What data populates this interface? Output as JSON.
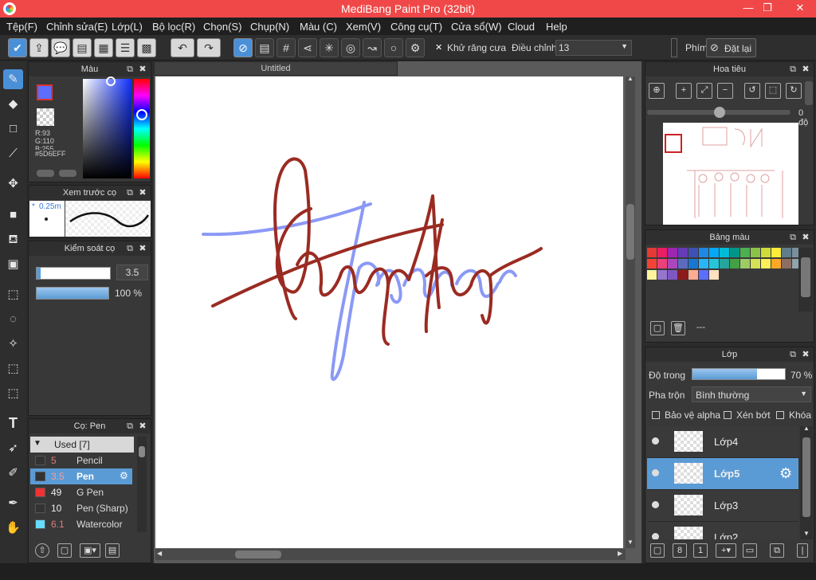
{
  "window": {
    "title": "MediBang Paint Pro (32bit)",
    "minimize": "—",
    "maximize": "❐",
    "close": "✕"
  },
  "menu": [
    "Tệp(F)",
    "Chỉnh sửa(E)",
    "Lớp(L)",
    "Bộ lọc(R)",
    "Chọn(S)",
    "Chụp(N)",
    "Màu (C)",
    "Xem(V)",
    "Công cụ(T)",
    "Cửa sổ(W)",
    "Cloud",
    "Help"
  ],
  "toolbar": {
    "antialias_label": "Khử răng cưa",
    "adjust_label": "Điều chỉnh",
    "adjust_value": "13",
    "key_label": "Phím",
    "reset_label": "Đặt lại"
  },
  "color_panel": {
    "title": "Màu",
    "r": "R:93",
    "g": "G:110",
    "b": "B:255",
    "hex": "#5D6EFF",
    "fg_color": "#5d6eff",
    "bg_color": "#ff66cc"
  },
  "preview_panel": {
    "title": "Xem trước cọ",
    "size": "0.25m"
  },
  "brush_control": {
    "title": "Kiểm soát cọ",
    "size_value": "3.5",
    "opacity_value": "100 %",
    "size_fraction": 0.05,
    "opacity_fraction": 1.0
  },
  "brush_panel": {
    "title": "Cọ: Pen",
    "group": "Used [7]",
    "items": [
      {
        "size": "5",
        "name": "Pencil",
        "color": "#333333",
        "size_color": "#e07a7a"
      },
      {
        "size": "3.5",
        "name": "Pen",
        "color": "#333333",
        "size_color": "#f0a0a0",
        "selected": true
      },
      {
        "size": "49",
        "name": "G Pen",
        "color": "#ee3333",
        "size_color": "#eeeeee"
      },
      {
        "size": "10",
        "name": "Pen (Sharp)",
        "color": "#333333",
        "size_color": "#eeeeee"
      },
      {
        "size": "6.1",
        "name": "Watercolor",
        "color": "#66ddff",
        "size_color": "#e07a7a"
      }
    ]
  },
  "document": {
    "tab": "Untitled"
  },
  "navigator": {
    "title": "Hoa tiêu",
    "rotation": "0 độ"
  },
  "palette": {
    "title": "Bảng màu",
    "rows": [
      [
        "#e53935",
        "#e91e63",
        "#9c27b0",
        "#673ab7",
        "#3f51b5",
        "#1e88e5",
        "#03a9f4",
        "#00bcd4",
        "#009688",
        "#4caf50",
        "#8bc34a",
        "#cddc39",
        "#ffeb3b",
        "#607d8b",
        "#78909c",
        "#42a5f5"
      ],
      [
        "#f44336",
        "#ec407a",
        "#ab47bc",
        "#5c6bc0",
        "#1976d2",
        "#29b6f6",
        "#26c6da",
        "#26a69a",
        "#43a047",
        "#9ccc65",
        "#d4e157",
        "#ffee58",
        "#ffa726",
        "#8d6e63",
        "#90a4ae",
        "#64b5f6"
      ],
      [
        "#fff59d",
        "#9575cd",
        "#7e57c2",
        "#8e1b1b",
        "#ffab91",
        "#5d6eff",
        "#ffe0c0"
      ]
    ],
    "none_label": "---"
  },
  "layers": {
    "title": "Lớp",
    "opacity_label": "Độ trong",
    "opacity_value": "70 %",
    "opacity_fraction": 0.7,
    "blend_label": "Pha trộn",
    "blend_value": "Bình thường",
    "protect_alpha": "Bảo vệ alpha",
    "clipping": "Xén bớt",
    "lock": "Khóa",
    "items": [
      {
        "name": "Lớp4",
        "selected": false
      },
      {
        "name": "Lớp5",
        "selected": true
      },
      {
        "name": "Lớp3",
        "selected": false
      },
      {
        "name": "Lớp2",
        "selected": false
      }
    ]
  }
}
